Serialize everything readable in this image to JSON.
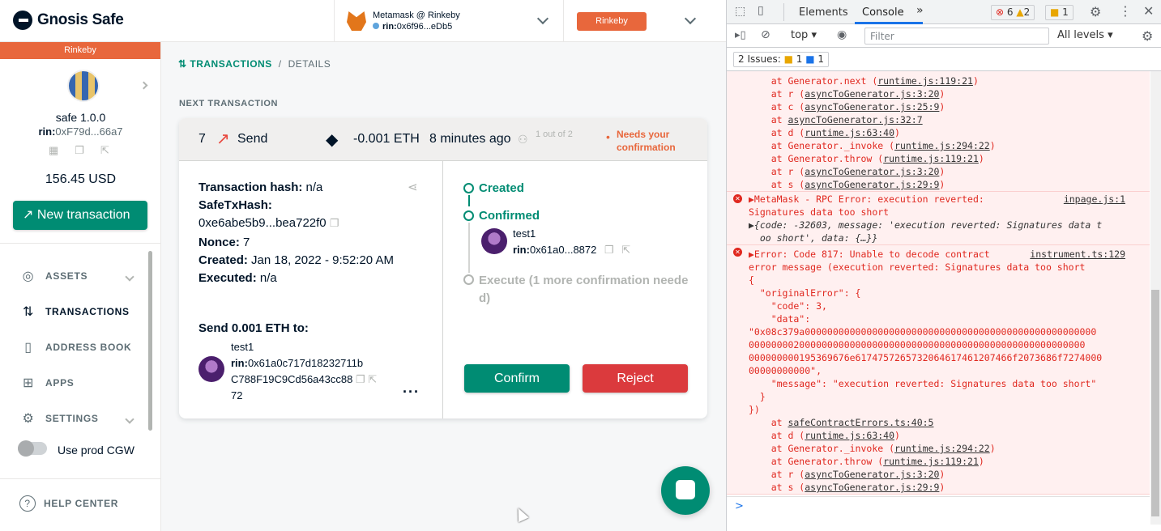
{
  "header": {
    "app_name": "Gnosis Safe",
    "wallet_name": "Metamask @ Rinkeby",
    "wallet_prefix": "rin:",
    "wallet_address": "0x6f96...eDb5",
    "network_button": "Rinkeby"
  },
  "sidebar": {
    "network_banner": "Rinkeby",
    "safe_name": "safe 1.0.0",
    "safe_prefix": "rin:",
    "safe_address": "0xF79d...66a7",
    "balance": "156.45 USD",
    "new_tx_label": "New transaction",
    "items": [
      {
        "label": "ASSETS",
        "icon": "assets-icon"
      },
      {
        "label": "TRANSACTIONS",
        "icon": "transactions-icon"
      },
      {
        "label": "ADDRESS BOOK",
        "icon": "address-book-icon"
      },
      {
        "label": "APPS",
        "icon": "apps-icon"
      },
      {
        "label": "SETTINGS",
        "icon": "settings-icon"
      }
    ],
    "toggle_label": "Use prod CGW",
    "help_center": "HELP CENTER"
  },
  "breadcrumb": {
    "section": "TRANSACTIONS",
    "separator": "/",
    "page": "DETAILS"
  },
  "next_tx_label": "NEXT TRANSACTION",
  "tx": {
    "nonce": "7",
    "type": "Send",
    "amount": "-0.001 ETH",
    "time": "8 minutes ago",
    "confirmations": "1 out of 2",
    "status": "Needs your confirmation",
    "hash_label": "Transaction hash:",
    "hash_value": "n/a",
    "safe_tx_hash_label": "SafeTxHash:",
    "safe_tx_hash_value": "0xe6abe5b9...bea722f0",
    "nonce_label": "Nonce:",
    "created_label": "Created:",
    "created_value": "Jan 18, 2022 - 9:52:20 AM",
    "executed_label": "Executed:",
    "executed_value": "n/a",
    "send_label": "Send 0.001 ETH to:",
    "recipient_name": "test1",
    "recipient_prefix": "rin:",
    "recipient_line1": "0x61a0c717d18232711b",
    "recipient_line2": "C788F19C9Cd56a43cc88",
    "recipient_line3": "72",
    "timeline": {
      "created": "Created",
      "confirmed": "Confirmed",
      "owner_name": "test1",
      "owner_prefix": "rin:",
      "owner_address": "0x61a0...8872",
      "execute_line1": "Execute (1 more confirmation neede",
      "execute_line2": "d)"
    },
    "confirm_label": "Confirm",
    "reject_label": "Reject"
  },
  "devtools": {
    "tabs": [
      "Elements",
      "Console"
    ],
    "errors_count": "6",
    "warnings_count": "2",
    "issues_count": "1",
    "context": "top",
    "filter_placeholder": "Filter",
    "levels": "All levels",
    "issues_label": "2 Issues:",
    "issues_warn": "1",
    "issues_info": "1",
    "prompt": ">"
  },
  "console": {
    "stack1": [
      {
        "prefix": "    at Generator.next (",
        "file": "runtime.js:119:21",
        "suffix": ")"
      },
      {
        "prefix": "    at r (",
        "file": "asyncToGenerator.js:3:20",
        "suffix": ")"
      },
      {
        "prefix": "    at c (",
        "file": "asyncToGenerator.js:25:9",
        "suffix": ")"
      },
      {
        "prefix": "    at ",
        "file": "asyncToGenerator.js:32:7",
        "suffix": ""
      },
      {
        "prefix": "    at d (",
        "file": "runtime.js:63:40",
        "suffix": ")"
      },
      {
        "prefix": "    at Generator._invoke (",
        "file": "runtime.js:294:22",
        "suffix": ")"
      },
      {
        "prefix": "    at Generator.throw (",
        "file": "runtime.js:119:21",
        "suffix": ")"
      },
      {
        "prefix": "    at r (",
        "file": "asyncToGenerator.js:3:20",
        "suffix": ")"
      },
      {
        "prefix": "    at s (",
        "file": "asyncToGenerator.js:29:9",
        "suffix": ")"
      }
    ],
    "err2_line1": "▶MetaMask - RPC Error: execution reverted:",
    "err2_source": "inpage.js:1",
    "err2_line2": "Signatures data too short",
    "err2_line3": "▶{code: -32603, message: 'execution reverted: Signatures data t",
    "err2_line4": "  oo short', data: {…}}",
    "err3_line1": "▶Error: Code 817: Unable to decode contract",
    "err3_source": "instrument.ts:129",
    "err3_lines": [
      "error message (execution reverted: Signatures data too short",
      "{",
      "  \"originalError\": {",
      "    \"code\": 3,",
      "    \"data\":",
      "\"0x08c379a0000000000000000000000000000000000000000000000000000",
      "000000002000000000000000000000000000000000000000000000000000",
      "000000000195369676e6174757265732064617461207466f2073686f7274000",
      "00000000000\",",
      "    \"message\": \"execution reverted: Signatures data too short\"",
      "  }",
      "})"
    ],
    "stack3": [
      {
        "prefix": "    at ",
        "file": "safeContractErrors.ts:40:5",
        "suffix": ""
      },
      {
        "prefix": "    at d (",
        "file": "runtime.js:63:40",
        "suffix": ")"
      },
      {
        "prefix": "    at Generator._invoke (",
        "file": "runtime.js:294:22",
        "suffix": ")"
      },
      {
        "prefix": "    at Generator.throw (",
        "file": "runtime.js:119:21",
        "suffix": ")"
      },
      {
        "prefix": "    at r (",
        "file": "asyncToGenerator.js:3:20",
        "suffix": ")"
      },
      {
        "prefix": "    at s (",
        "file": "asyncToGenerator.js:29:9",
        "suffix": ")"
      }
    ]
  }
}
